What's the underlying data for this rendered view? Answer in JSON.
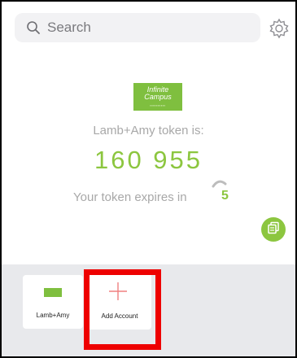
{
  "search": {
    "placeholder": "Search"
  },
  "token": {
    "label": "Lamb+Amy token is:",
    "code": "160  955",
    "expires_text": "Your token expires in",
    "countdown": "5"
  },
  "logo": {
    "line1": "Infinite",
    "line2": "Campus"
  },
  "accounts": [
    {
      "label": "Lamb+Amy"
    },
    {
      "label": "Add Account"
    }
  ],
  "colors": {
    "accent": "#8cc63f",
    "highlight": "#ee0000",
    "bottom_bar": "#e8e9ec"
  },
  "icons": [
    "search-icon",
    "gear-icon",
    "copy-icon",
    "plus-icon",
    "countdown-ring-icon"
  ]
}
